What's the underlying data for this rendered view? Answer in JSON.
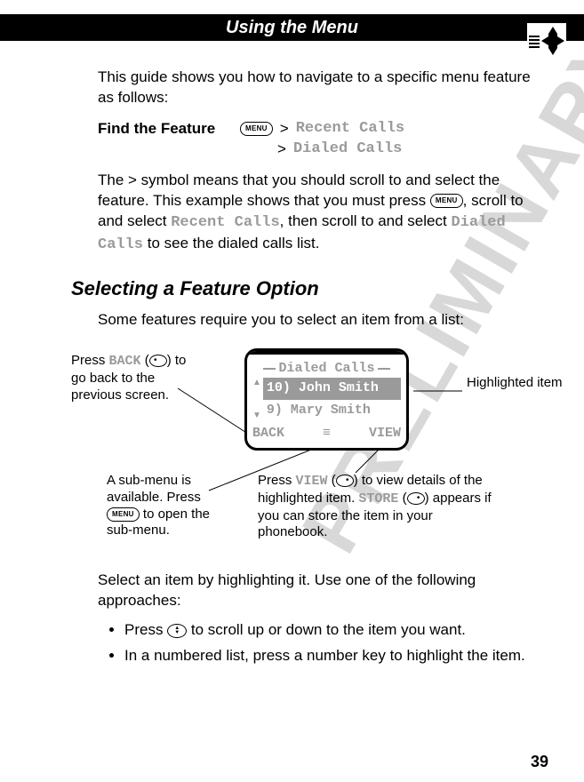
{
  "header": {
    "title": "Using the Menu"
  },
  "watermark": "PRELIMINARY",
  "intro": "This guide shows you how to navigate to a specific menu feature as follows:",
  "feature": {
    "label": "Find the Feature",
    "path1": "Recent Calls",
    "path2": "Dialed Calls"
  },
  "explain": {
    "p1a": "The > symbol means that you should scroll to and select the feature. This example shows that you must press ",
    "p1b": ", scroll to and select ",
    "p1_recent": "Recent Calls",
    "p1c": ", then scroll to and select ",
    "p1_dialed": "Dialed Calls",
    "p1d": " to see the dialed calls list."
  },
  "section_title": "Selecting a Feature Option",
  "section_intro": "Some features require you to select an item from a list:",
  "screen": {
    "title": "Dialed Calls",
    "row1": "10) John Smith",
    "row2": "9) Mary Smith",
    "soft_left": "BACK",
    "soft_right": "VIEW",
    "menu_glyph": "≡"
  },
  "callouts": {
    "back_a": "Press ",
    "back_key": "BACK",
    "back_b": " (",
    "back_c": ") to go back to the previous screen.",
    "submenu_a": "A sub-menu is available. Press ",
    "submenu_b": " to open the sub-menu.",
    "view_a": "Press ",
    "view_key": "VIEW",
    "view_b": " (",
    "view_c": ") to view details of the highlighted item. ",
    "store_key": "STORE",
    "view_d": " (",
    "view_e": ") appears if you can store the item in your phonebook.",
    "highlight": "Highlighted item"
  },
  "select_para": "Select an item by highlighting it. Use one of the following approaches:",
  "bullets": {
    "b1a": "Press ",
    "b1b": " to scroll up or down to the item you want.",
    "b2": "In a numbered list, press a number key to highlight the item."
  },
  "page_number": "39"
}
